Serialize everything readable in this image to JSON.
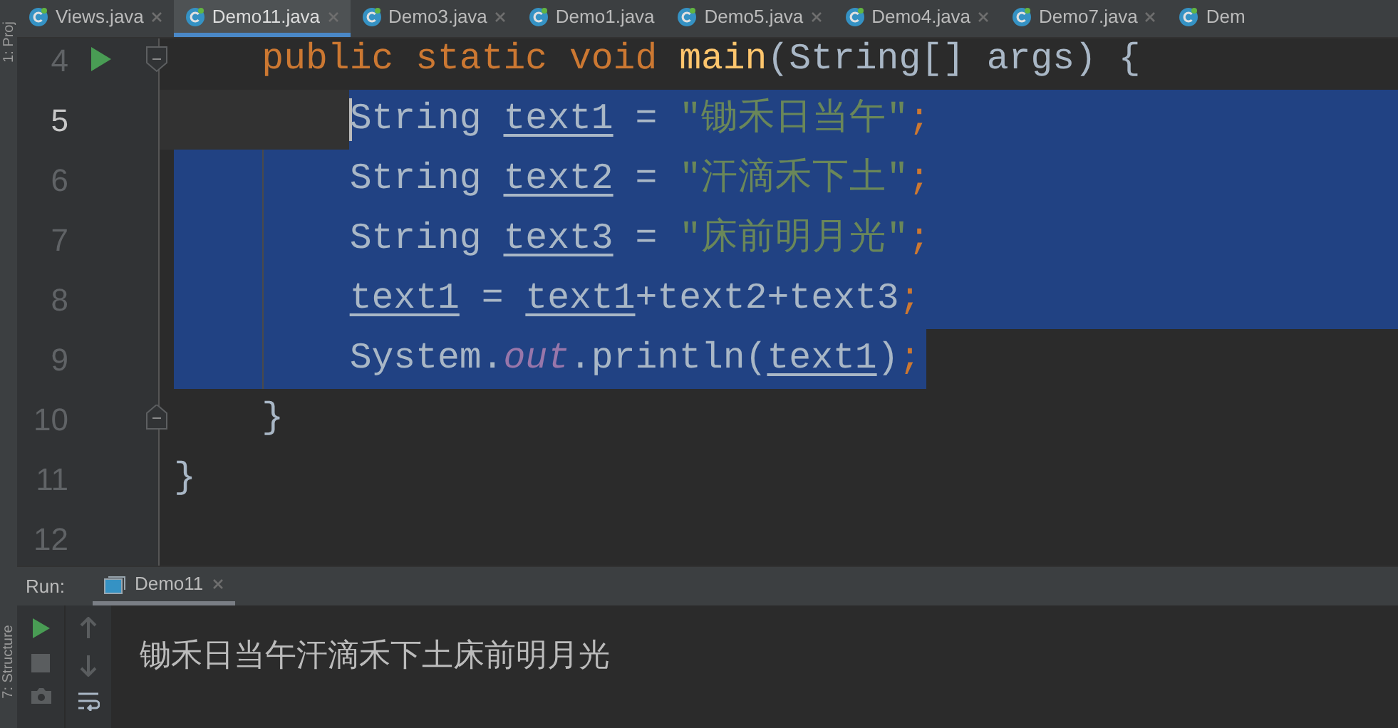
{
  "side_tools": [
    {
      "label": "1: Proj"
    },
    {
      "label": "7: Structure"
    }
  ],
  "tabs": [
    {
      "label": "Views.java",
      "selected": false,
      "closable": true
    },
    {
      "label": "Demo11.java",
      "selected": true,
      "closable": true
    },
    {
      "label": "Demo3.java",
      "selected": false,
      "closable": true
    },
    {
      "label": "Demo1.java",
      "selected": false,
      "closable": false
    },
    {
      "label": "Demo5.java",
      "selected": false,
      "closable": true
    },
    {
      "label": "Demo4.java",
      "selected": false,
      "closable": true
    },
    {
      "label": "Demo7.java",
      "selected": false,
      "closable": true
    },
    {
      "label": "Dem",
      "selected": false,
      "closable": false
    }
  ],
  "editor": {
    "lines": [
      {
        "number": "4",
        "run_marker": true,
        "fold_start": true,
        "fold_end": false,
        "selected": false,
        "caret": false,
        "tokens": [
          {
            "kind": "keyword",
            "text": "    public static void "
          },
          {
            "kind": "method",
            "text": "main"
          },
          {
            "kind": "plain",
            "text": "(String[] args) {"
          }
        ]
      },
      {
        "number": "5",
        "run_marker": false,
        "fold_start": false,
        "fold_end": false,
        "selected": true,
        "caret": true,
        "tokens": [
          {
            "kind": "plain",
            "text": "        String "
          },
          {
            "kind": "var",
            "text": "text1"
          },
          {
            "kind": "plain",
            "text": " = "
          },
          {
            "kind": "string",
            "text": "\"锄禾日当午\""
          },
          {
            "kind": "punct",
            "text": ";"
          }
        ]
      },
      {
        "number": "6",
        "run_marker": false,
        "fold_start": false,
        "fold_end": false,
        "selected": true,
        "caret": false,
        "tokens": [
          {
            "kind": "plain",
            "text": "        String "
          },
          {
            "kind": "var",
            "text": "text2"
          },
          {
            "kind": "plain",
            "text": " = "
          },
          {
            "kind": "string",
            "text": "\"汗滴禾下土\""
          },
          {
            "kind": "punct",
            "text": ";"
          }
        ]
      },
      {
        "number": "7",
        "run_marker": false,
        "fold_start": false,
        "fold_end": false,
        "selected": true,
        "caret": false,
        "tokens": [
          {
            "kind": "plain",
            "text": "        String "
          },
          {
            "kind": "var",
            "text": "text3"
          },
          {
            "kind": "plain",
            "text": " = "
          },
          {
            "kind": "string",
            "text": "\"床前明月光\""
          },
          {
            "kind": "punct",
            "text": ";"
          }
        ]
      },
      {
        "number": "8",
        "run_marker": false,
        "fold_start": false,
        "fold_end": false,
        "selected": true,
        "caret": false,
        "tokens": [
          {
            "kind": "var",
            "text": "        text1"
          },
          {
            "kind": "plain",
            "text": " = "
          },
          {
            "kind": "var",
            "text": "text1"
          },
          {
            "kind": "plain",
            "text": "+text2+text3"
          },
          {
            "kind": "punct",
            "text": ";"
          }
        ]
      },
      {
        "number": "9",
        "run_marker": false,
        "fold_start": false,
        "fold_end": false,
        "selected": true,
        "caret": false,
        "tokens": [
          {
            "kind": "plain",
            "text": "        System."
          },
          {
            "kind": "field",
            "text": "out"
          },
          {
            "kind": "plain",
            "text": ".println("
          },
          {
            "kind": "var",
            "text": "text1"
          },
          {
            "kind": "plain",
            "text": ")"
          },
          {
            "kind": "punct",
            "text": ";"
          }
        ]
      },
      {
        "number": "10",
        "run_marker": false,
        "fold_start": false,
        "fold_end": true,
        "selected": false,
        "caret": false,
        "tokens": [
          {
            "kind": "plain",
            "text": "    }"
          }
        ]
      },
      {
        "number": "11",
        "run_marker": false,
        "fold_start": false,
        "fold_end": false,
        "selected": false,
        "caret": false,
        "tokens": [
          {
            "kind": "plain",
            "text": "}"
          }
        ]
      },
      {
        "number": "12",
        "run_marker": false,
        "fold_start": false,
        "fold_end": false,
        "selected": false,
        "caret": false
      }
    ]
  },
  "run_panel": {
    "label": "Run:",
    "tab": {
      "label": "Demo11",
      "selected": true
    },
    "output": "锄禾日当午汗滴禾下土床前明月光"
  }
}
